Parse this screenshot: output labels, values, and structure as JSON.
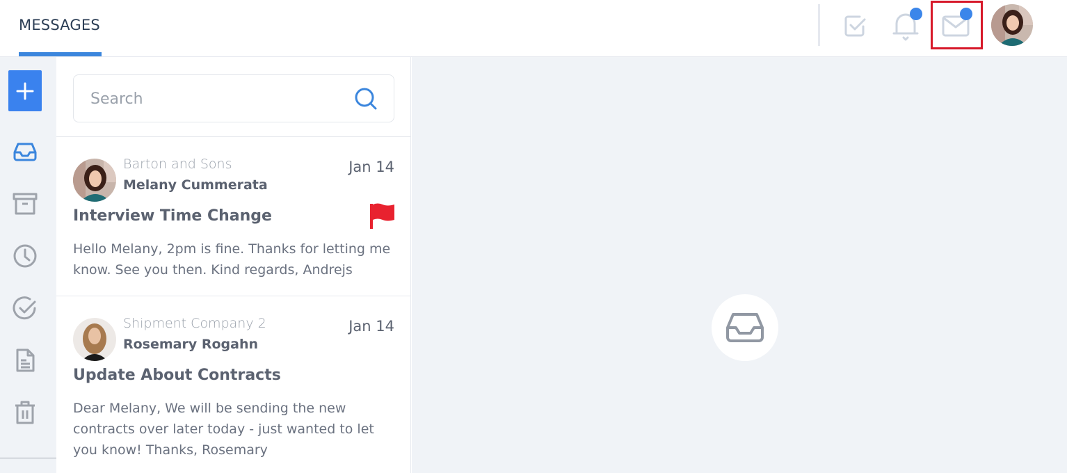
{
  "header": {
    "title": "MESSAGES",
    "icons": {
      "tasks": "checkbox-icon",
      "notifications": "bell-icon",
      "messages": "mail-icon",
      "profile": "user-avatar"
    },
    "badge_color": "#3b86ea",
    "highlight_color": "#d7192a"
  },
  "sidebar": {
    "compose_icon": "plus-icon",
    "accent": "#3a82ee",
    "items": [
      {
        "name": "inbox",
        "icon": "inbox-icon",
        "active": true
      },
      {
        "name": "archive",
        "icon": "archive-icon",
        "active": false
      },
      {
        "name": "snoozed",
        "icon": "clock-icon",
        "active": false
      },
      {
        "name": "done",
        "icon": "check-circle-icon",
        "active": false
      },
      {
        "name": "drafts",
        "icon": "document-icon",
        "active": false
      },
      {
        "name": "trash",
        "icon": "trash-icon",
        "active": false
      }
    ]
  },
  "search": {
    "placeholder": "Search",
    "value": ""
  },
  "messages": [
    {
      "company": "Barton and Sons",
      "sender": "Melany Cummerata",
      "date": "Jan 14",
      "subject": "Interview Time Change",
      "preview": "Hello Melany, 2pm is fine. Thanks for letting me know. See you then. Kind regards, Andrejs",
      "flagged": true
    },
    {
      "company": "Shipment Company 2",
      "sender": "Rosemary Rogahn",
      "date": "Jan 14",
      "subject": "Update About Contracts",
      "preview": "Dear Melany, We will be sending the new contracts over later today - just wanted to let you know! Thanks, Rosemary",
      "flagged": false
    }
  ],
  "detail": {
    "empty_icon": "inbox-icon"
  }
}
